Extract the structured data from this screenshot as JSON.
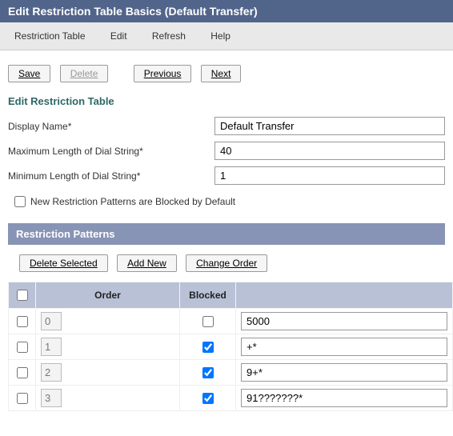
{
  "title": "Edit Restriction Table Basics  (Default Transfer)",
  "menu": {
    "restriction_table": "Restriction Table",
    "edit": "Edit",
    "refresh": "Refresh",
    "help": "Help"
  },
  "toolbar": {
    "save": "Save",
    "delete": "Delete",
    "previous": "Previous",
    "next": "Next"
  },
  "section_title": "Edit Restriction Table",
  "form": {
    "display_name_label": "Display Name*",
    "display_name_value": "Default Transfer",
    "max_len_label": "Maximum Length of Dial String*",
    "max_len_value": "40",
    "min_len_label": "Minimum Length of Dial String*",
    "min_len_value": "1",
    "blocked_default_label": "New Restriction Patterns are Blocked by Default"
  },
  "patterns_header": "Restriction Patterns",
  "patterns_toolbar": {
    "delete_selected": "Delete Selected",
    "add_new": "Add New",
    "change_order": "Change Order"
  },
  "table": {
    "headers": {
      "order": "Order",
      "blocked": "Blocked"
    },
    "rows": [
      {
        "order": "0",
        "blocked": false,
        "pattern": "5000"
      },
      {
        "order": "1",
        "blocked": true,
        "pattern": "+*"
      },
      {
        "order": "2",
        "blocked": true,
        "pattern": "9+*"
      },
      {
        "order": "3",
        "blocked": true,
        "pattern": "91???????*"
      }
    ]
  }
}
